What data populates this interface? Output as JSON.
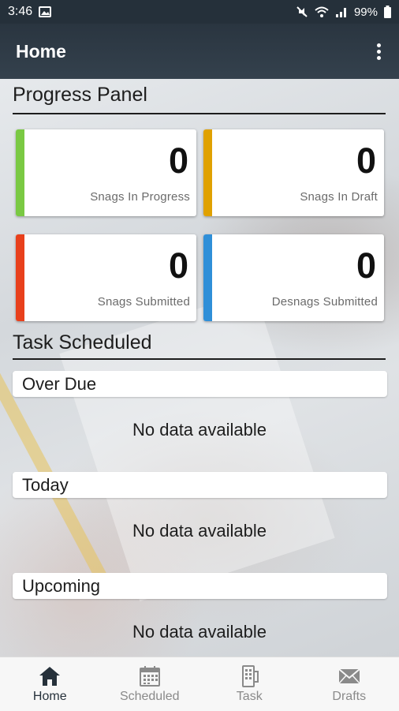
{
  "status_bar": {
    "time": "3:46",
    "battery": "99%"
  },
  "app_bar": {
    "title": "Home"
  },
  "progress_panel": {
    "title": "Progress Panel",
    "cards": [
      {
        "value": "0",
        "label": "Snags In Progress",
        "color": "#7ac943"
      },
      {
        "value": "0",
        "label": "Snags In Draft",
        "color": "#e0a100"
      },
      {
        "value": "0",
        "label": "Snags Submitted",
        "color": "#e8401c"
      },
      {
        "value": "0",
        "label": "Desnags Submitted",
        "color": "#2f8fd8"
      }
    ]
  },
  "task_scheduled": {
    "title": "Task Scheduled",
    "groups": [
      {
        "label": "Over Due",
        "empty_text": "No data available"
      },
      {
        "label": "Today",
        "empty_text": "No data available"
      },
      {
        "label": "Upcoming",
        "empty_text": "No data available"
      }
    ]
  },
  "bottom_nav": {
    "items": [
      {
        "label": "Home",
        "icon": "home-icon"
      },
      {
        "label": "Scheduled",
        "icon": "calendar-icon"
      },
      {
        "label": "Task",
        "icon": "task-icon"
      },
      {
        "label": "Drafts",
        "icon": "envelope-icon"
      }
    ],
    "active": "Home"
  }
}
